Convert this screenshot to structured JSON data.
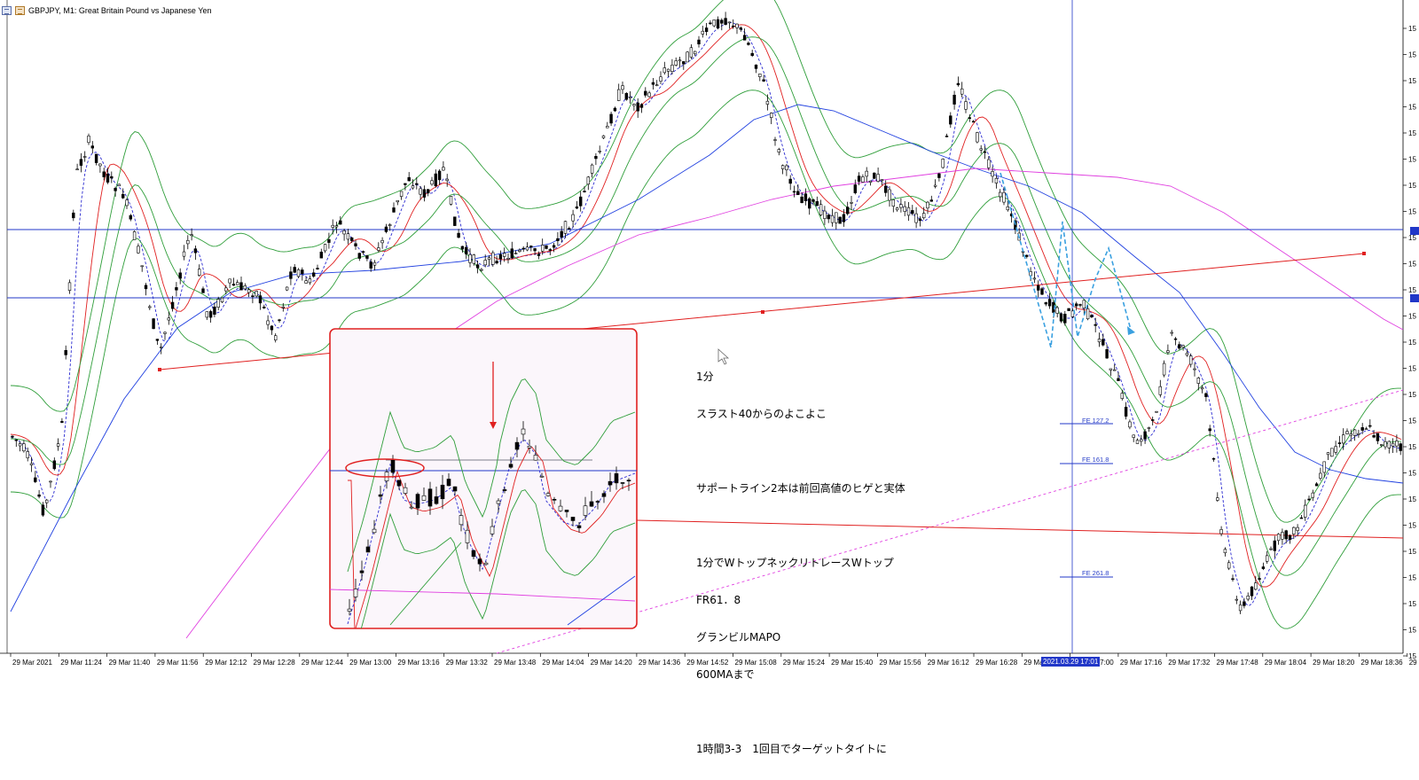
{
  "window": {
    "title": "GBPJPY, M1:  Great Britain Pound vs Japanese Yen"
  },
  "annotation": {
    "lines": [
      "1分",
      "スラスト40からのよこよこ",
      "",
      "サポートライン2本は前回高値のヒゲと実体",
      "",
      "1分でWトップネックリトレースWトップ",
      "FR61．8",
      "グランビルMAPO",
      "600MAまで",
      "",
      "1時間3-3　1回目でターゲットタイトに"
    ]
  },
  "fibo_labels": [
    "FE 127.2",
    "FE 161.8",
    "FE 261.8"
  ],
  "time_axis": {
    "labels": [
      "29 Mar 2021",
      "29 Mar 11:24",
      "29 Mar 11:40",
      "29 Mar 11:56",
      "29 Mar 12:12",
      "29 Mar 12:28",
      "29 Mar 12:44",
      "29 Mar 13:00",
      "29 Mar 13:16",
      "29 Mar 13:32",
      "29 Mar 13:48",
      "29 Mar 14:04",
      "29 Mar 14:20",
      "29 Mar 14:36",
      "29 Mar 14:52",
      "29 Mar 15:08",
      "29 Mar 15:24",
      "29 Mar 15:40",
      "29 Mar 15:56",
      "29 Mar 16:12",
      "29 Mar 16:28",
      "29 Mar 16:44",
      "29 Mar 17:00",
      "29 Mar 17:16",
      "29 Mar 17:32",
      "29 Mar 17:48",
      "29 Mar 18:04",
      "29 Mar 18:20",
      "29 Mar 18:36",
      "29 Ma"
    ],
    "highlight": "2021.03.29 17:01"
  },
  "price_axis": {
    "labels": [
      "15",
      "15",
      "15",
      "15",
      "15",
      "15",
      "15",
      "15",
      "15",
      "15",
      "15",
      "15",
      "15",
      "15",
      "15",
      "15",
      "15",
      "15",
      "15",
      "15",
      "15",
      "15",
      "15",
      "15",
      "15"
    ]
  },
  "colors": {
    "bollinger": "#2f9e3a",
    "ma_red": "#e02020",
    "ma_blue": "#2040e0",
    "ma_magenta": "#e040e0",
    "dotted_ma": "#2a2ad0",
    "hline": "#2137c8",
    "inset_border": "#e02020",
    "w_pattern": "#3aa0e0"
  }
}
